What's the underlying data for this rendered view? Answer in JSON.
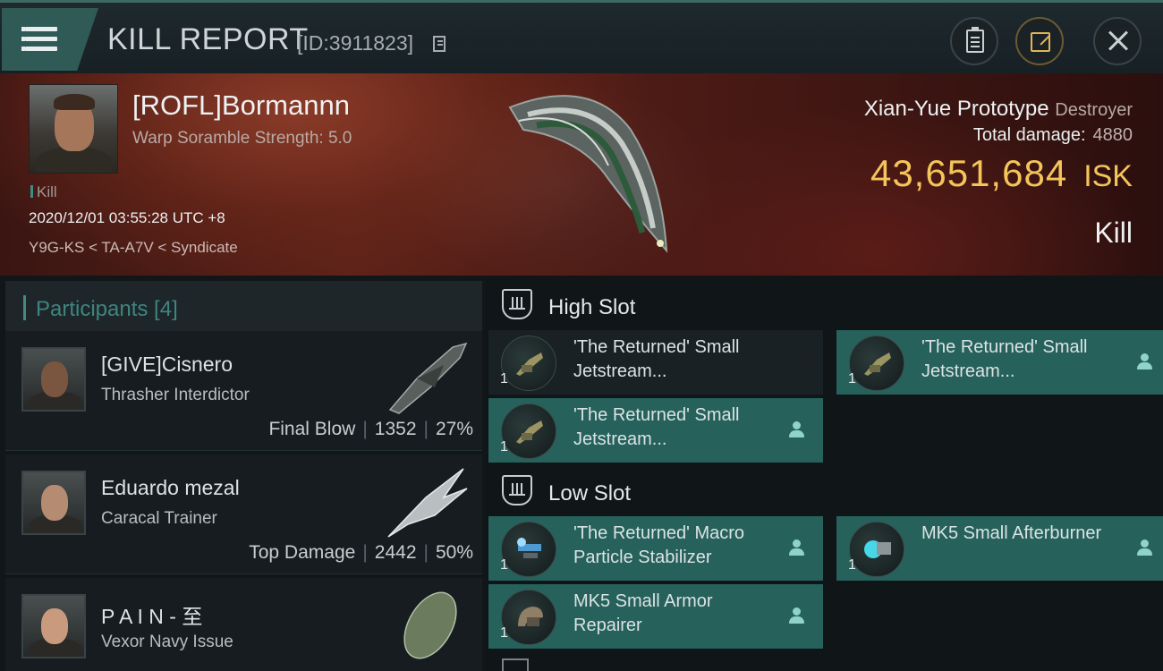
{
  "window": {
    "title": "KILL REPORT",
    "report_id": "[ID:3911823]",
    "icons": [
      "menu-icon",
      "copy-icon",
      "clipboard-icon",
      "share-icon",
      "close-icon"
    ]
  },
  "victim": {
    "name": "[ROFL]Bormannn",
    "warp_scramble": "Warp Soramble Strength: 5.0",
    "type_tag": "Kill",
    "datetime": "2020/12/01 03:55:28 UTC +8",
    "location": "Y9G-KS < TA-A7V < Syndicate"
  },
  "ship": {
    "name": "Xian-Yue Prototype",
    "class": "Destroyer",
    "total_damage_label": "Total damage:",
    "total_damage": "4880",
    "isk_value": "43,651,684",
    "isk_unit": "ISK",
    "result": "Kill"
  },
  "participants": {
    "title": "Participants [4]",
    "rows": [
      {
        "name": "[GIVE]Cisnero",
        "ship": "Thrasher Interdictor",
        "role": "Final Blow",
        "damage": "1352",
        "percent": "27%"
      },
      {
        "name": "Eduardo mezal",
        "ship": "Caracal Trainer",
        "role": "Top Damage",
        "damage": "2442",
        "percent": "50%"
      },
      {
        "name": "P A I N - 至",
        "ship": "Vexor Navy Issue"
      }
    ]
  },
  "slots": {
    "high": {
      "title": "High Slot",
      "modules": [
        {
          "name": "'The Returned' Small Jetstream...",
          "qty": "1",
          "state": "destroyed"
        },
        {
          "name": "'The Returned' Small Jetstream...",
          "qty": "1",
          "state": "dropped"
        },
        {
          "name": "'The Returned' Small Jetstream...",
          "qty": "1",
          "state": "dropped"
        }
      ]
    },
    "low": {
      "title": "Low Slot",
      "modules": [
        {
          "name": "'The Returned' Macro Particle Stabilizer",
          "qty": "1",
          "state": "dropped"
        },
        {
          "name": "MK5 Small Afterburner",
          "qty": "1",
          "state": "dropped"
        },
        {
          "name": "MK5 Small Armor Repairer",
          "qty": "1",
          "state": "dropped"
        }
      ]
    }
  },
  "colors": {
    "accent": "#26615c",
    "isk": "#f3c55a",
    "teal_text": "#3f8580"
  }
}
